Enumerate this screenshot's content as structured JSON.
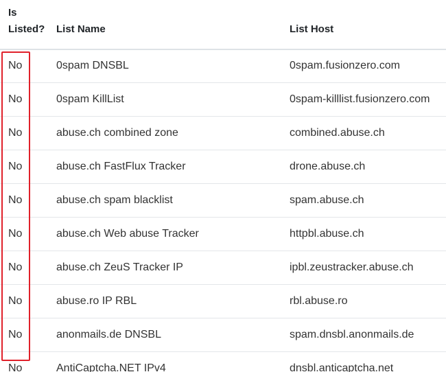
{
  "table": {
    "headers": {
      "is_listed_line1": "Is",
      "is_listed_line2": "Listed?",
      "list_name": "List Name",
      "list_host": "List Host"
    },
    "rows": [
      {
        "is_listed": "No",
        "list_name": "0spam DNSBL",
        "list_host": "0spam.fusionzero.com"
      },
      {
        "is_listed": "No",
        "list_name": "0spam KillList",
        "list_host": "0spam-killlist.fusionzero.com"
      },
      {
        "is_listed": "No",
        "list_name": "abuse.ch combined zone",
        "list_host": "combined.abuse.ch"
      },
      {
        "is_listed": "No",
        "list_name": "abuse.ch FastFlux Tracker",
        "list_host": "drone.abuse.ch"
      },
      {
        "is_listed": "No",
        "list_name": "abuse.ch spam blacklist",
        "list_host": "spam.abuse.ch"
      },
      {
        "is_listed": "No",
        "list_name": "abuse.ch Web abuse Tracker",
        "list_host": "httpbl.abuse.ch"
      },
      {
        "is_listed": "No",
        "list_name": "abuse.ch ZeuS Tracker IP",
        "list_host": "ipbl.zeustracker.abuse.ch"
      },
      {
        "is_listed": "No",
        "list_name": "abuse.ro IP RBL",
        "list_host": "rbl.abuse.ro"
      },
      {
        "is_listed": "No",
        "list_name": "anonmails.de DNSBL",
        "list_host": "spam.dnsbl.anonmails.de"
      },
      {
        "is_listed": "No",
        "list_name": "AntiCaptcha.NET IPv4",
        "list_host": "dnsbl.anticaptcha.net"
      }
    ]
  },
  "colors": {
    "highlight": "#e0202a",
    "text": "#333333",
    "header_text": "#212529",
    "row_border": "#e3e6e9"
  }
}
